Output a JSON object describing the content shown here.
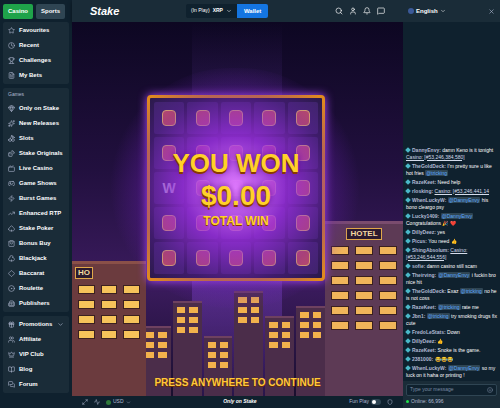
{
  "header": {
    "tabs": [
      {
        "label": "Casino",
        "selected": true
      },
      {
        "label": "Sports",
        "selected": false
      }
    ],
    "logo": "Stake",
    "balance": "(In Play)",
    "currency": "XRP",
    "wallet_button": "Wallet",
    "language": "English"
  },
  "sidebar": {
    "top_items": [
      {
        "label": "Favourites",
        "has_submenu": false
      },
      {
        "label": "Recent",
        "has_submenu": false
      },
      {
        "label": "Challenges",
        "has_submenu": false
      },
      {
        "label": "My Bets",
        "has_submenu": false
      }
    ],
    "section_label": "Games",
    "game_items": [
      {
        "label": "Only on Stake",
        "has_submenu": false
      },
      {
        "label": "New Releases",
        "has_submenu": false
      },
      {
        "label": "Slots",
        "has_submenu": false
      },
      {
        "label": "Stake Originals",
        "has_submenu": false
      },
      {
        "label": "Live Casino",
        "has_submenu": false
      },
      {
        "label": "Game Shows",
        "has_submenu": false
      },
      {
        "label": "Burst Games",
        "has_submenu": false
      },
      {
        "label": "Enhanced RTP",
        "has_submenu": false
      },
      {
        "label": "Stake Poker",
        "has_submenu": false
      },
      {
        "label": "Bonus Buy",
        "has_submenu": false
      },
      {
        "label": "Blackjack",
        "has_submenu": false
      },
      {
        "label": "Baccarat",
        "has_submenu": false
      },
      {
        "label": "Roulette",
        "has_submenu": false
      },
      {
        "label": "Publishers",
        "has_submenu": false
      }
    ],
    "bottom_items": [
      {
        "label": "Promotions",
        "has_submenu": true
      },
      {
        "label": "Affiliate",
        "has_submenu": false
      },
      {
        "label": "VIP Club",
        "has_submenu": false
      },
      {
        "label": "Blog",
        "has_submenu": false
      },
      {
        "label": "Forum",
        "has_submenu": false
      }
    ]
  },
  "game": {
    "title_line": "YOU WON",
    "amount": "$0.00",
    "subtitle": "TOTAL WIN",
    "prompt": "PRESS ANYWHERE TO CONTINUE",
    "grid_symbol": "W",
    "signs": {
      "left": "HO",
      "right": "HOTEL"
    }
  },
  "footer": {
    "currency": "USD",
    "brand": "Only on Stake",
    "fun_play": "Fun Play",
    "fun_play_on": false
  },
  "chat": {
    "messages": [
      {
        "user": "DannyEnvy",
        "parts": [
          {
            "text": "damn Keno is it tonight",
            "kind": "plain"
          },
          {
            "text": "Casino: [#53,246,384,580]",
            "kind": "link"
          }
        ]
      },
      {
        "user": "TheGoldDeck",
        "parts": [
          {
            "text": "I'm pretty sure u like hot fries",
            "kind": "plain"
          },
          {
            "text": "@tricking",
            "kind": "mention"
          }
        ]
      },
      {
        "user": "RazeKeet",
        "parts": [
          {
            "text": "Need help",
            "kind": "plain"
          }
        ]
      },
      {
        "user": "rlosking",
        "parts": [
          {
            "text": "Casino: [#53,246,441,14",
            "kind": "link"
          }
        ]
      },
      {
        "user": "WhenLuckyW",
        "parts": [
          {
            "text": "@DannyEnvy",
            "kind": "mention"
          },
          {
            "text": "his bono cleargo psy",
            "kind": "plain"
          }
        ]
      },
      {
        "user": "Lucky1409",
        "parts": [
          {
            "text": "@DannyEnvy",
            "kind": "mention"
          },
          {
            "text": "Congratulations 🎉 ❤️",
            "kind": "plain"
          }
        ]
      },
      {
        "user": "DillyDeez",
        "parts": [
          {
            "text": "yes",
            "kind": "plain"
          }
        ]
      },
      {
        "user": "Picus",
        "parts": [
          {
            "text": "You need 👍",
            "kind": "plain"
          }
        ]
      },
      {
        "user": "ShingAbsolum",
        "parts": [
          {
            "text": "Casino: [#53,246,544,556]",
            "kind": "link"
          }
        ]
      },
      {
        "user": "sofie",
        "parts": [
          {
            "text": "damn casino still scam",
            "kind": "plain"
          }
        ]
      },
      {
        "user": "Theirving",
        "parts": [
          {
            "text": "@DannyEnvy",
            "kind": "mention"
          },
          {
            "text": "i fuckin bro nice hit",
            "kind": "plain"
          }
        ]
      },
      {
        "user": "TheGoldDeck",
        "parts": [
          {
            "text": "Exaz",
            "kind": "plain"
          },
          {
            "text": "@tricking",
            "kind": "mention"
          },
          {
            "text": "no he is not coss",
            "kind": "plain"
          }
        ]
      },
      {
        "user": "RazeKeet",
        "parts": [
          {
            "text": "@tricking",
            "kind": "mention"
          },
          {
            "text": "rate me",
            "kind": "plain"
          }
        ]
      },
      {
        "user": "Jbn1",
        "parts": [
          {
            "text": "@tricking",
            "kind": "mention"
          },
          {
            "text": "try smoking drugs fix cute",
            "kind": "plain"
          }
        ]
      },
      {
        "user": "FredoLeStats",
        "parts": [
          {
            "text": "Down",
            "kind": "plain"
          }
        ]
      },
      {
        "user": "DillyDeez",
        "parts": [
          {
            "text": "👍",
            "kind": "plain"
          }
        ]
      },
      {
        "user": "RazeKeet",
        "parts": [
          {
            "text": "Snoke is the game.",
            "kind": "plain"
          }
        ]
      },
      {
        "user": "2381000",
        "parts": [
          {
            "text": "😂😂😂",
            "kind": "plain"
          }
        ]
      },
      {
        "user": "WhenLuckyW",
        "parts": [
          {
            "text": "@DannyEnvy",
            "kind": "mention"
          },
          {
            "text": "so my luck on it haha or printing !",
            "kind": "plain"
          }
        ]
      }
    ],
    "input_placeholder": "Type your message",
    "online": "Online: 66,996"
  }
}
